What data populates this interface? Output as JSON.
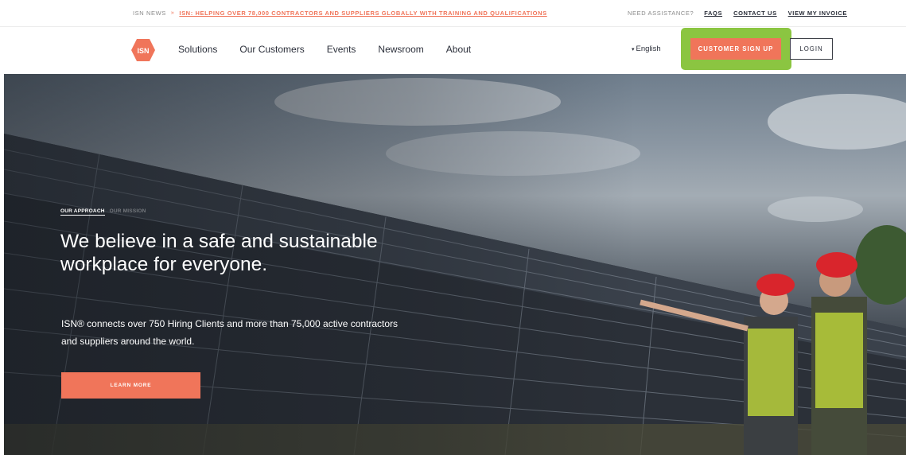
{
  "topbar": {
    "news_label": "ISN NEWS",
    "news_separator": "»",
    "news_headline": "ISN: HELPING OVER 78,000 CONTRACTORS AND SUPPLIERS GLOBALLY WITH TRAINING AND QUALIFICATIONS",
    "assist_label": "NEED ASSISTANCE?",
    "links": [
      "FAQS",
      "CONTACT US",
      "VIEW MY INVOICE"
    ]
  },
  "nav": {
    "logo_text": "ISN",
    "logo_icon": "isn-hexagon-logo",
    "links": [
      "Solutions",
      "Our Customers",
      "Events",
      "Newsroom",
      "About"
    ],
    "language": "English",
    "language_caret": "▾",
    "signup_label": "CUSTOMER SIGN UP",
    "login_label": "LOGIN"
  },
  "hero": {
    "tabs": [
      "OUR APPROACH",
      "OUR MISSION"
    ],
    "headline": "We believe in a safe and sustainable workplace for everyone.",
    "body": "ISN® connects over 750 Hiring Clients and more than 75,000 active contractors and suppliers around the world.",
    "cta_label": "LEARN MORE",
    "image": "solar-panels-workers-hard-hats"
  },
  "colors": {
    "accent": "#f0755a",
    "highlight": "#8bc541",
    "text_dark": "#2b2f3a"
  }
}
